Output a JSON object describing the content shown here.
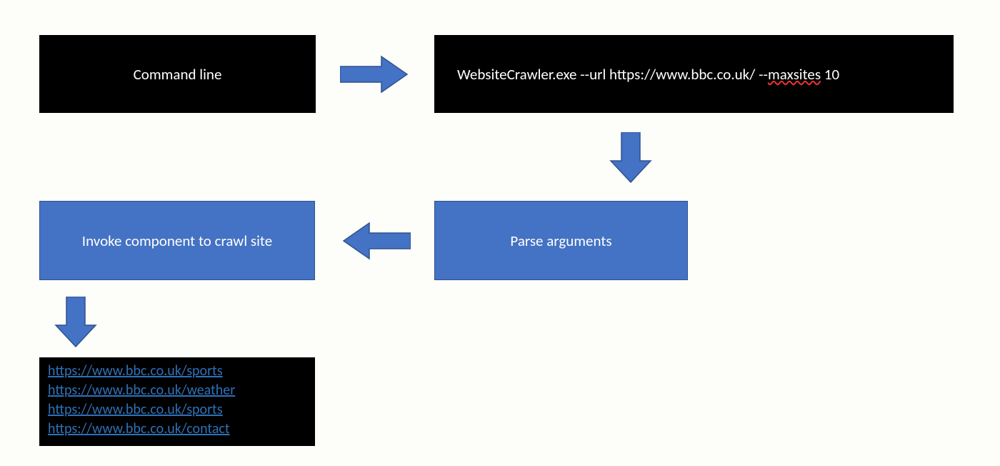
{
  "nodes": {
    "command_line": {
      "label": "Command line"
    },
    "cmd_example": {
      "prefix": "WebsiteCrawler.exe --url https://www.bbc.co.uk/  --",
      "squiggle": "maxsites",
      "suffix": " 10"
    },
    "parse_args": {
      "label": "Parse arguments"
    },
    "invoke": {
      "label": "Invoke component to crawl site"
    }
  },
  "output_urls": [
    "https://www.bbc.co.uk/sports",
    "https://www.bbc.co.uk/weather",
    "https://www.bbc.co.uk/sports",
    "https://www.bbc.co.uk/contact"
  ],
  "colors": {
    "arrow_fill": "#4472c4",
    "arrow_stroke": "#2f528f"
  }
}
